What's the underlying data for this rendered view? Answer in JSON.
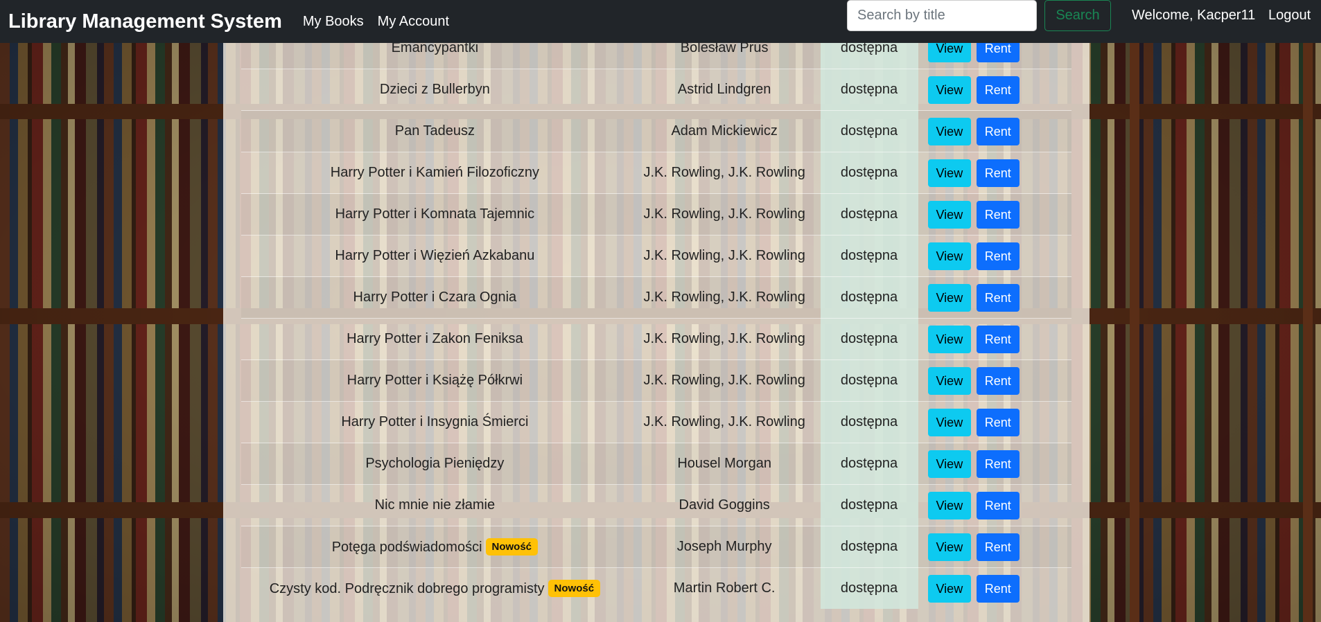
{
  "navbar": {
    "brand": "Library Management System",
    "links": [
      "My Books",
      "My Account"
    ],
    "search_placeholder": "Search by title",
    "search_button": "Search",
    "welcome": "Welcome, Kacper11",
    "logout": "Logout"
  },
  "books": [
    {
      "title": "Emancypantki",
      "author": "Bolesław Prus",
      "status": "dostępna",
      "badge": ""
    },
    {
      "title": "Dzieci z Bullerbyn",
      "author": "Astrid Lindgren",
      "status": "dostępna",
      "badge": ""
    },
    {
      "title": "Pan Tadeusz",
      "author": "Adam Mickiewicz",
      "status": "dostępna",
      "badge": ""
    },
    {
      "title": "Harry Potter i Kamień Filozoficzny",
      "author": "J.K. Rowling, J.K. Rowling",
      "status": "dostępna",
      "badge": ""
    },
    {
      "title": "Harry Potter i Komnata Tajemnic",
      "author": "J.K. Rowling, J.K. Rowling",
      "status": "dostępna",
      "badge": ""
    },
    {
      "title": "Harry Potter i Więzień Azkabanu",
      "author": "J.K. Rowling, J.K. Rowling",
      "status": "dostępna",
      "badge": ""
    },
    {
      "title": "Harry Potter i Czara Ognia",
      "author": "J.K. Rowling, J.K. Rowling",
      "status": "dostępna",
      "badge": ""
    },
    {
      "title": "Harry Potter i Zakon Feniksa",
      "author": "J.K. Rowling, J.K. Rowling",
      "status": "dostępna",
      "badge": ""
    },
    {
      "title": "Harry Potter i Książę Półkrwi",
      "author": "J.K. Rowling, J.K. Rowling",
      "status": "dostępna",
      "badge": ""
    },
    {
      "title": "Harry Potter i Insygnia Śmierci",
      "author": "J.K. Rowling, J.K. Rowling",
      "status": "dostępna",
      "badge": ""
    },
    {
      "title": "Psychologia Pieniędzy",
      "author": "Housel Morgan",
      "status": "dostępna",
      "badge": ""
    },
    {
      "title": "Nic mnie nie złamie",
      "author": "David Goggins",
      "status": "dostępna",
      "badge": ""
    },
    {
      "title": "Potęga podświadomości",
      "author": "Joseph Murphy",
      "status": "dostępna",
      "badge": "Nowość"
    },
    {
      "title": "Czysty kod. Podręcznik dobrego programisty",
      "author": "Martin Robert C.",
      "status": "dostępna",
      "badge": "Nowość"
    }
  ],
  "actions": {
    "view": "View",
    "rent": "Rent"
  }
}
